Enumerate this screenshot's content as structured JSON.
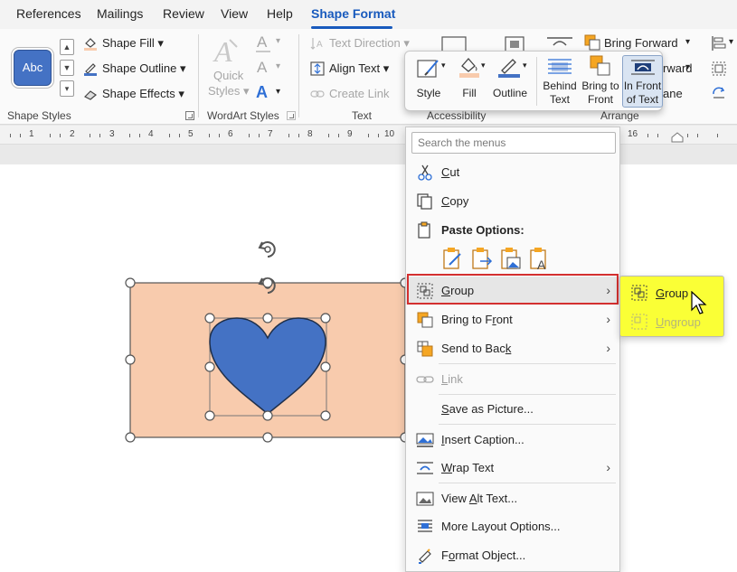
{
  "tabs": [
    "References",
    "Mailings",
    "Review",
    "View",
    "Help",
    "Shape Format"
  ],
  "ribbon": {
    "shape_styles": {
      "abc_label": "Abc",
      "fill": "Shape Fill",
      "outline": "Shape Outline",
      "effects": "Shape Effects",
      "group_label": "Shape Styles"
    },
    "wordart": {
      "quick_styles_line1": "Quick",
      "quick_styles_line2": "Styles",
      "group_label": "WordArt Styles"
    },
    "text": {
      "direction": "Text Direction",
      "align": "Align Text",
      "create_link": "Create Link",
      "group_label": "Text"
    },
    "accessibility_label": "Accessibility",
    "arrange": {
      "bring_forward": "Bring Forward",
      "forward_partial": "rward",
      "pane_partial": "ane",
      "group_label": "Arrange"
    }
  },
  "mini_toolbar": {
    "style": "Style",
    "fill": "Fill",
    "outline": "Outline",
    "behind_line1": "Behind",
    "behind_line2": "Text",
    "bring_line1": "Bring to",
    "bring_line2": "Front",
    "infront_line1": "In Front",
    "infront_line2": "of Text"
  },
  "ruler_numbers": [
    "1",
    "2",
    "3",
    "4",
    "5",
    "6",
    "7",
    "8",
    "9",
    "10",
    "16"
  ],
  "context_menu": {
    "search_placeholder": "Search the menus",
    "cut": "Cut",
    "copy": "Copy",
    "paste_options": "Paste Options:",
    "group": "Group",
    "bring_to_front": "Bring to Front",
    "send_to_back": "Send to Back",
    "link": "Link",
    "save_as_picture": "Save as Picture...",
    "insert_caption": "Insert Caption...",
    "wrap_text": "Wrap Text",
    "view_alt_text": "View Alt Text...",
    "more_layout": "More Layout Options...",
    "format_object": "Format Object..."
  },
  "submenu": {
    "group": "Group",
    "ungroup": "Ungroup"
  },
  "colors": {
    "accent": "#185abd",
    "rectangle_fill": "#f8cbad",
    "heart_fill": "#4472c4",
    "submenu_highlight": "#faff36",
    "red_highlight": "#d32f2f"
  }
}
